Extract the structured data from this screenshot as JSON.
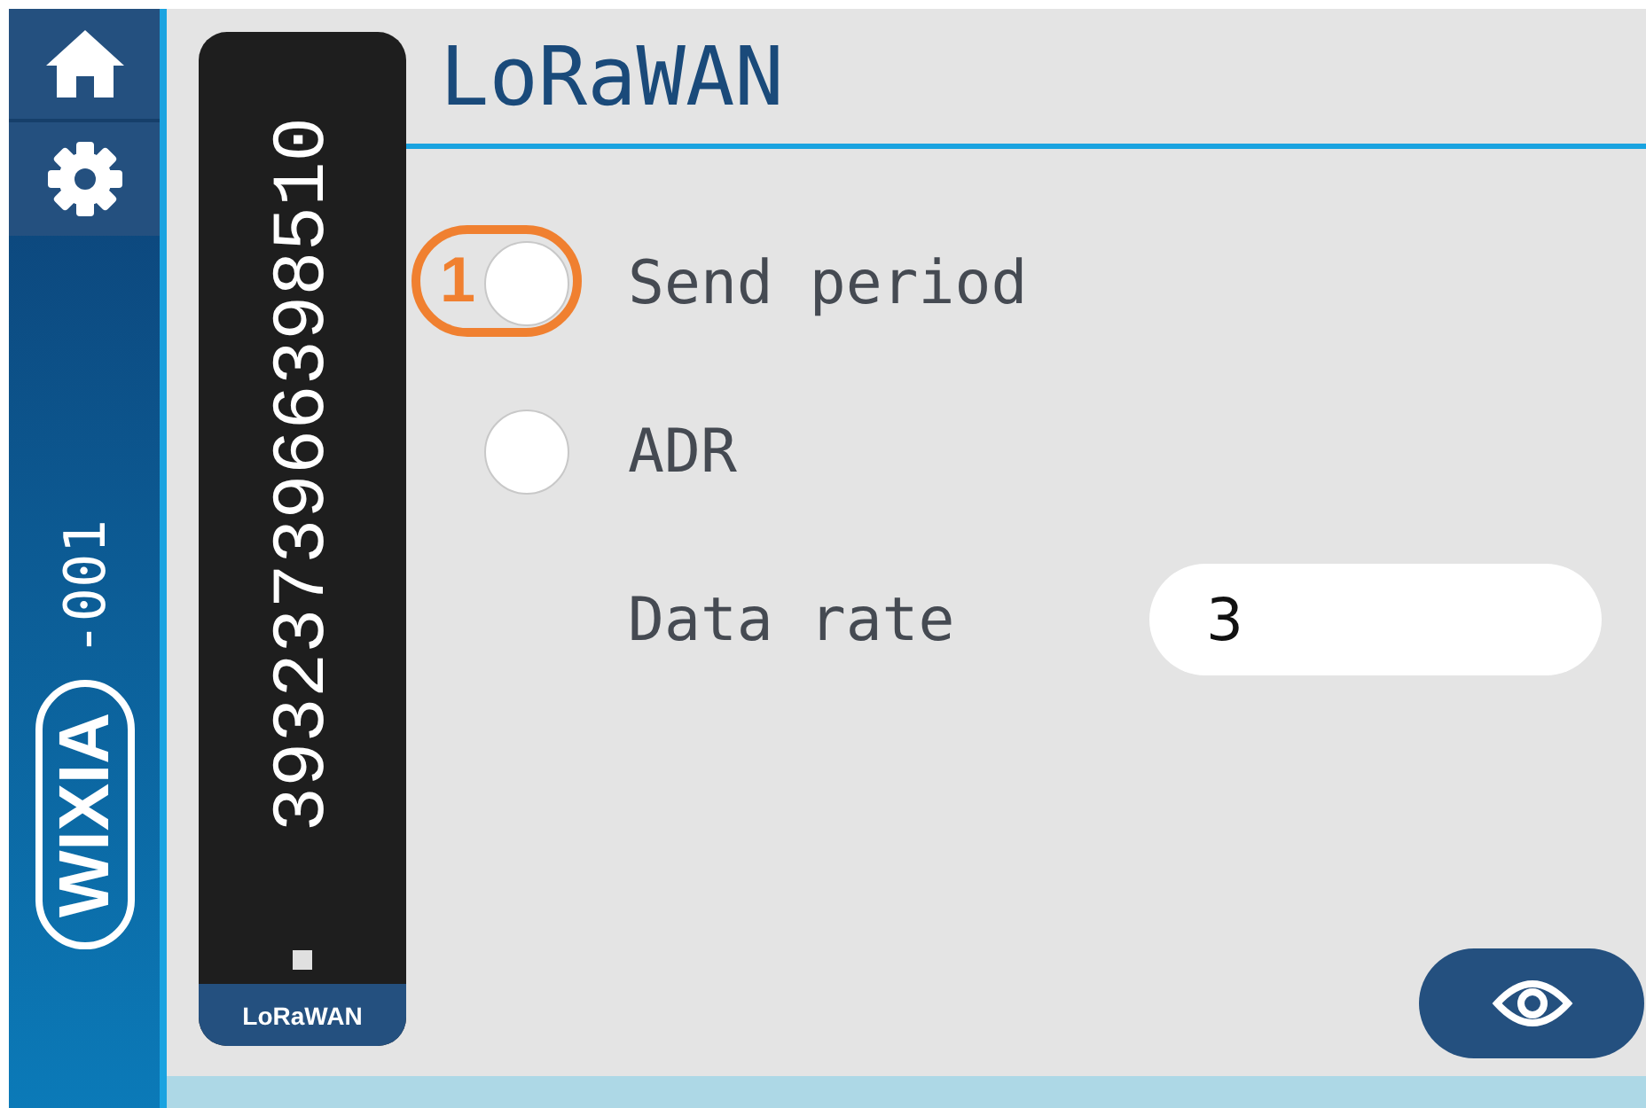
{
  "logo": {
    "brand": "WIXIA",
    "suffix": "-001"
  },
  "device_card": {
    "serial": "3932373966398510",
    "label": "LoRaWAN"
  },
  "title": "LoRaWAN",
  "options": [
    {
      "kind": "radio",
      "label": "Send period",
      "selected": false,
      "marker": "1"
    },
    {
      "kind": "radio",
      "label": "ADR",
      "selected": false
    },
    {
      "kind": "field",
      "label": "Data rate",
      "value": "3"
    }
  ]
}
